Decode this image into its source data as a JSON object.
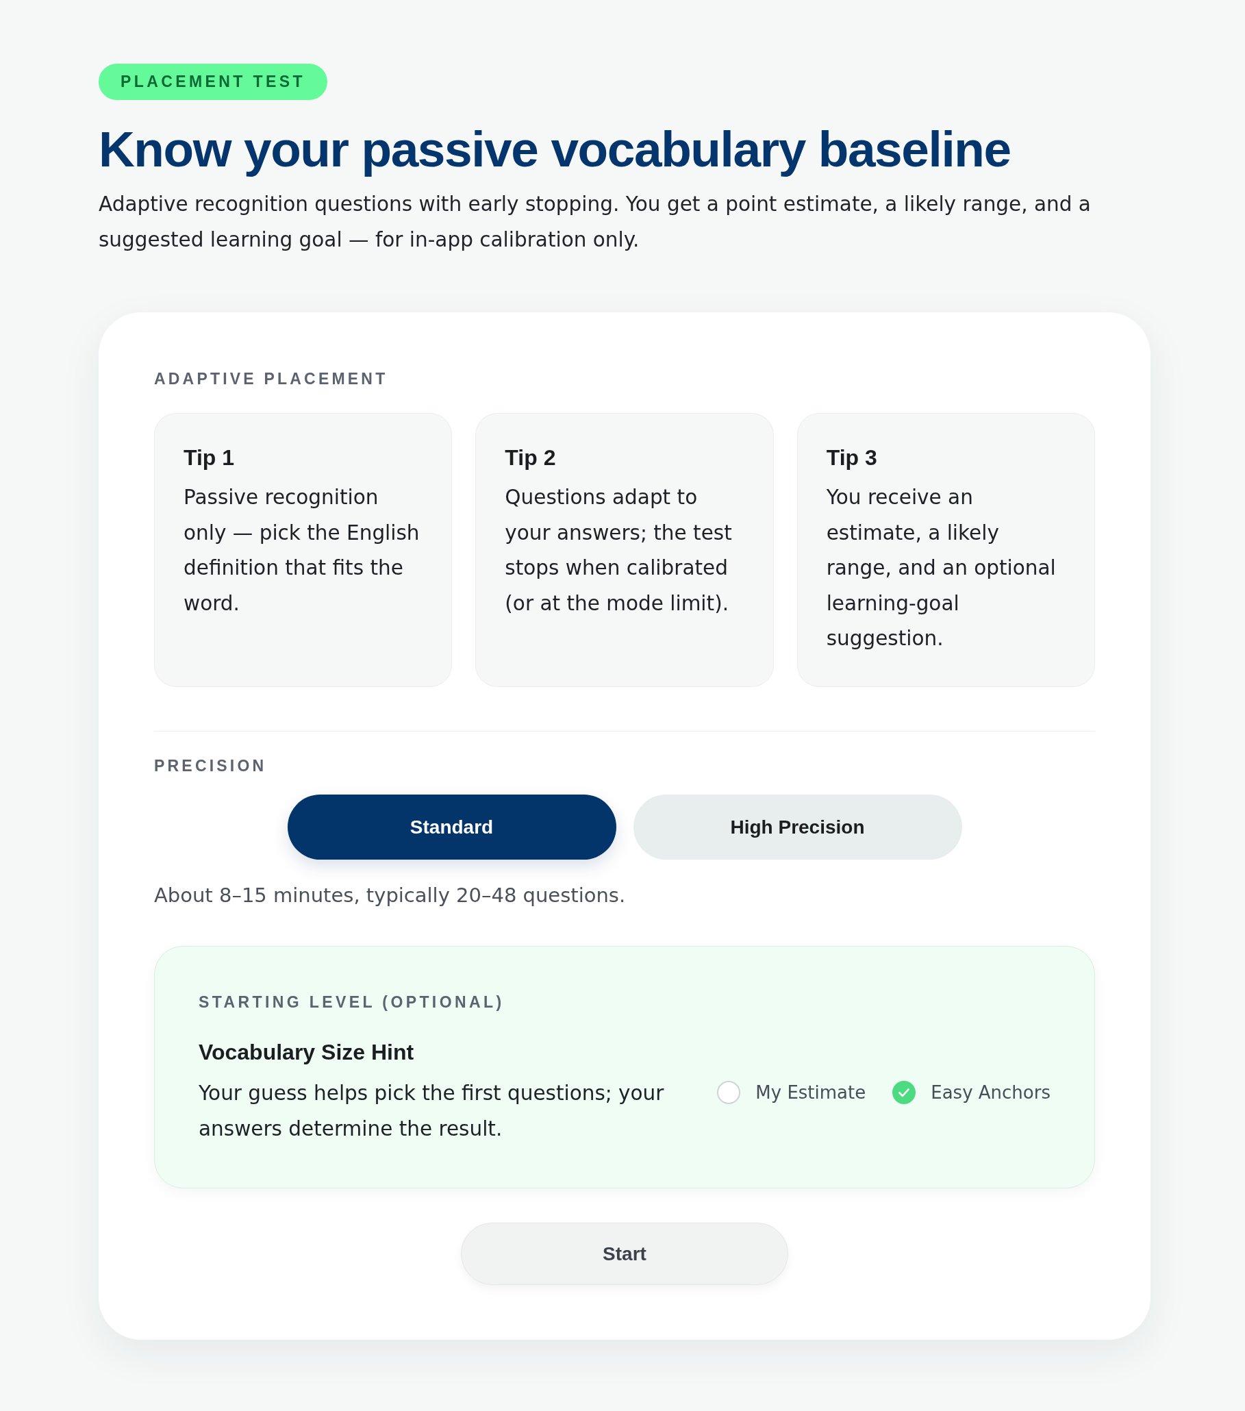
{
  "badge": "PLACEMENT TEST",
  "title": "Know your passive vocabulary baseline",
  "subtitle": "Adaptive recognition questions with early stopping. You get a point estimate, a likely range, and a suggested learning goal — for in-app calibration only.",
  "card": {
    "section_label": "ADAPTIVE PLACEMENT",
    "tips": [
      {
        "title": "Tip 1",
        "text": "Passive recognition only — pick the English definition that fits the word."
      },
      {
        "title": "Tip 2",
        "text": "Questions adapt to your answers; the test stops when calibrated (or at the mode limit)."
      },
      {
        "title": "Tip 3",
        "text": "You receive an estimate, a likely range, and an optional learning-goal suggestion."
      }
    ],
    "precision": {
      "label": "PRECISION",
      "options": [
        {
          "label": "Standard",
          "selected": true
        },
        {
          "label": "High Precision",
          "selected": false
        }
      ],
      "description": "About 8–15 minutes, typically 20–48 questions."
    },
    "starting_level": {
      "label": "STARTING LEVEL (OPTIONAL)",
      "title": "Vocabulary Size Hint",
      "text": "Your guess helps pick the first questions; your answers determine the result.",
      "options": [
        {
          "label": "My Estimate",
          "selected": false
        },
        {
          "label": "Easy Anchors",
          "selected": true
        }
      ]
    },
    "start_button": "Start"
  }
}
